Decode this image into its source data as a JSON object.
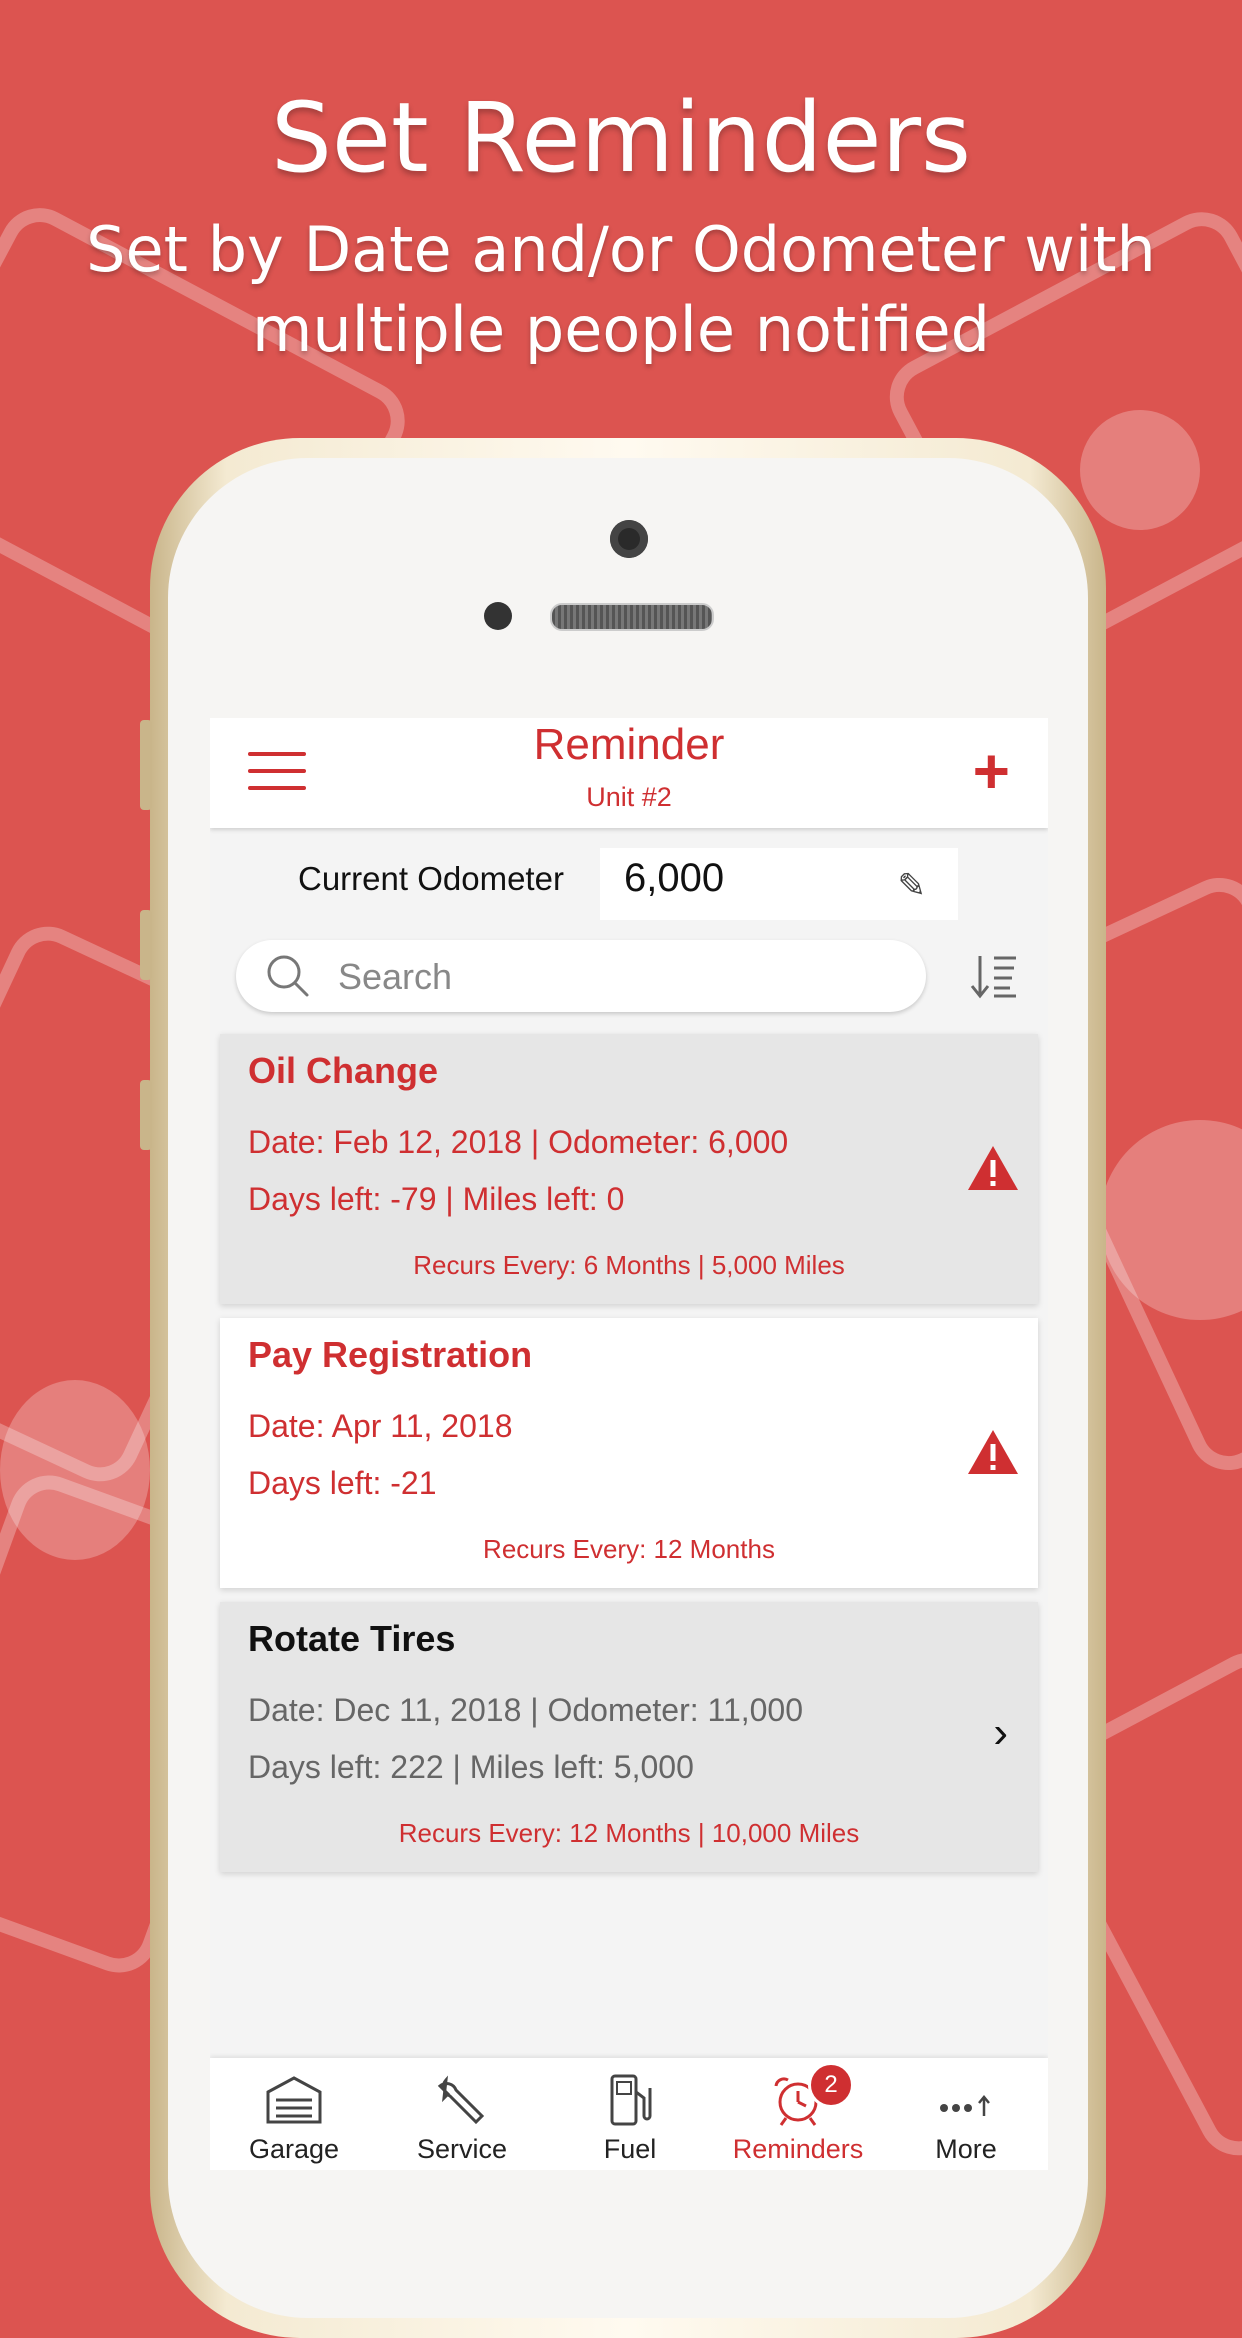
{
  "promo": {
    "headline": "Set Reminders",
    "subline": "Set by Date and/or Odometer with multiple people notified"
  },
  "navbar": {
    "title": "Reminder",
    "subtitle": "Unit #2",
    "add_label": "+"
  },
  "odometer": {
    "label": "Current Odometer",
    "value": "6,000"
  },
  "search": {
    "placeholder": "Search"
  },
  "reminders": [
    {
      "title": "Oil Change",
      "line1": "Date: Feb 12, 2018 | Odometer: 6,000",
      "line2": "Days left: -79 | Miles left: 0",
      "recurs": "Recurs Every: 6 Months | 5,000 Miles",
      "status": "overdue"
    },
    {
      "title": "Pay Registration",
      "line1": "Date: Apr 11, 2018",
      "line2": "Days left: -21",
      "recurs": "Recurs Every: 12 Months",
      "status": "overdue"
    },
    {
      "title": "Rotate Tires",
      "line1": "Date: Dec 11, 2018 | Odometer: 11,000",
      "line2": "Days left: 222 | Miles left: 5,000",
      "recurs": "Recurs Every: 12 Months | 10,000 Miles",
      "status": "upcoming"
    }
  ],
  "tabs": [
    {
      "label": "Garage",
      "icon": "garage-icon"
    },
    {
      "label": "Service",
      "icon": "wrench-icon"
    },
    {
      "label": "Fuel",
      "icon": "fuel-pump-icon"
    },
    {
      "label": "Reminders",
      "icon": "alarm-clock-icon",
      "badge": "2",
      "active": true
    },
    {
      "label": "More",
      "icon": "more-icon"
    }
  ],
  "colors": {
    "accent": "#cf2f31",
    "background": "#dc5450",
    "card_overdue_gray": "#e6e6e6",
    "card_white": "#ffffff"
  }
}
